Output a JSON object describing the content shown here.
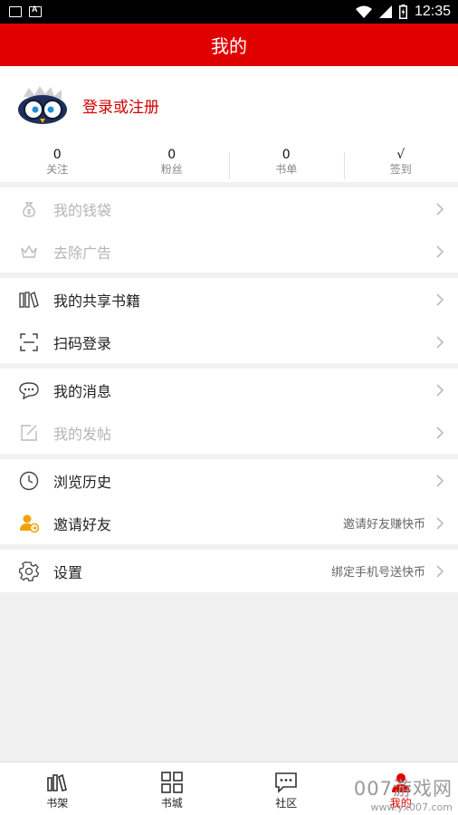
{
  "status_bar": {
    "time": "12:35"
  },
  "header": {
    "title": "我的"
  },
  "profile": {
    "login_text": "登录或注册"
  },
  "stats": [
    {
      "value": "0",
      "label": "关注"
    },
    {
      "value": "0",
      "label": "粉丝"
    },
    {
      "value": "0",
      "label": "书单"
    },
    {
      "value": "√",
      "label": "签到"
    }
  ],
  "menu": {
    "wallet": {
      "label": "我的钱袋",
      "icon": "wallet-icon"
    },
    "remove_ads": {
      "label": "去除广告",
      "icon": "crown-icon"
    },
    "shared_books": {
      "label": "我的共享书籍",
      "icon": "books-icon"
    },
    "scan_login": {
      "label": "扫码登录",
      "icon": "scan-icon"
    },
    "messages": {
      "label": "我的消息",
      "icon": "chat-bubble-icon"
    },
    "my_posts": {
      "label": "我的发帖",
      "icon": "edit-icon"
    },
    "history": {
      "label": "浏览历史",
      "icon": "clock-icon"
    },
    "invite": {
      "label": "邀请好友",
      "extra": "邀请好友赚快币",
      "icon": "invite-user-icon"
    },
    "settings": {
      "label": "设置",
      "extra": "绑定手机号送快币",
      "icon": "gear-icon"
    }
  },
  "bottom_nav": [
    {
      "label": "书架"
    },
    {
      "label": "书城"
    },
    {
      "label": "社区"
    },
    {
      "label": "我的"
    }
  ],
  "watermark": {
    "line1": "007游戏网",
    "line2": "www.yx007.com"
  },
  "colors": {
    "accent": "#e10000",
    "login": "#d10000",
    "background": "#f1f1f1"
  }
}
